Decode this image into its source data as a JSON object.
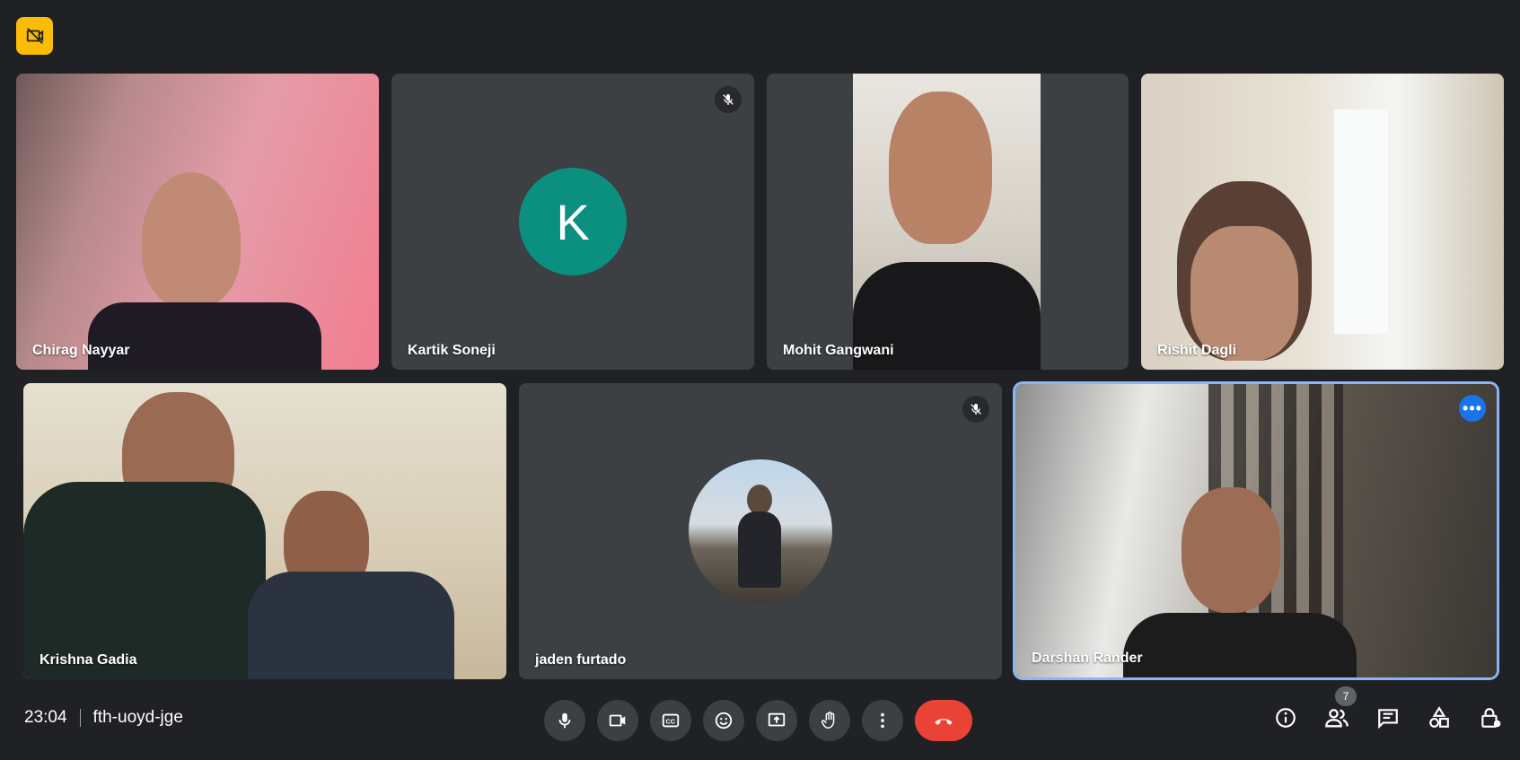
{
  "meeting": {
    "time": "23:04",
    "code": "fth-uoyd-jge"
  },
  "participants": [
    {
      "name": "Chirag Nayyar"
    },
    {
      "name": "Kartik Soneji",
      "avatar_letter": "K",
      "avatar_color": "#0b8f7f",
      "muted": true
    },
    {
      "name": "Mohit Gangwani"
    },
    {
      "name": "Rishit Dagli"
    },
    {
      "name": "Krishna Gadia"
    },
    {
      "name": "jaden furtado",
      "muted": true
    },
    {
      "name": "Darshan Rander",
      "selected": true
    }
  ],
  "people_count": "7",
  "colors": {
    "background": "#202124",
    "tile": "#3c4043",
    "end_call": "#ea4335",
    "accent": "#1a73e8",
    "badge": "#fbbc04"
  },
  "controls": [
    "microphone-icon",
    "camera-icon",
    "captions-icon",
    "emoji-icon",
    "present-icon",
    "raise-hand-icon",
    "more-options-icon",
    "end-call-icon"
  ],
  "right_controls": [
    "info-icon",
    "people-icon",
    "chat-icon",
    "activities-icon",
    "host-controls-icon"
  ]
}
